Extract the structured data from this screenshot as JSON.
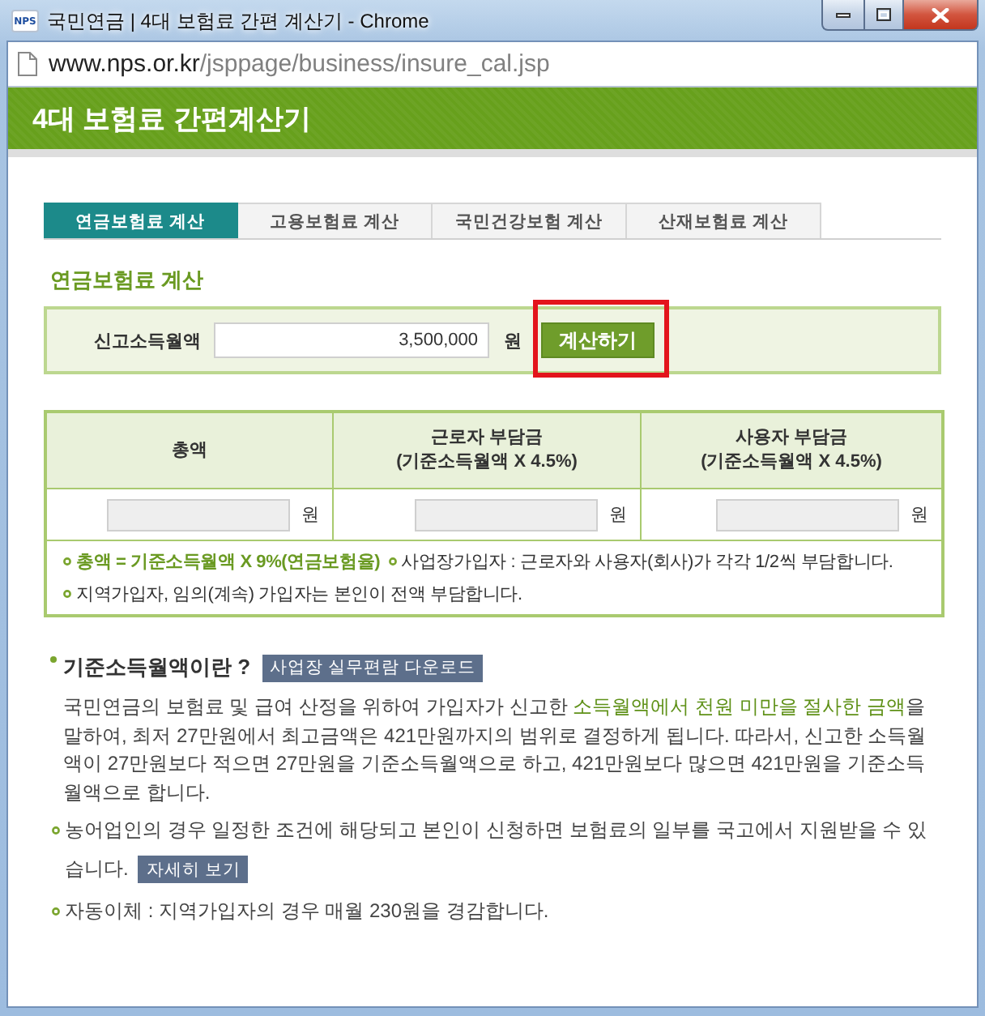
{
  "window": {
    "favicon_label": "NPS",
    "title": "국민연금 | 4대 보험료 간편 계산기 - Chrome"
  },
  "address_bar": {
    "host": "www.nps.or.kr",
    "path": "/jsppage/business/insure_cal.jsp"
  },
  "page_header": {
    "title": "4대 보험료 간편계산기"
  },
  "tabs": [
    {
      "label": "연금보험료 계산",
      "selected": true
    },
    {
      "label": "고용보험료 계산",
      "selected": false
    },
    {
      "label": "국민건강보험 계산",
      "selected": false
    },
    {
      "label": "산재보험료 계산",
      "selected": false
    }
  ],
  "section_title": "연금보험료 계산",
  "income_form": {
    "label": "신고소득월액",
    "value": "3,500,000",
    "unit": "원",
    "button": "계산하기",
    "highlighted": true
  },
  "result_table": {
    "columns": [
      {
        "title": "총액"
      },
      {
        "title": "근로자 부담금",
        "subtitle": "(기준소득월액 X 4.5%)"
      },
      {
        "title": "사용자 부담금",
        "subtitle": "(기준소득월액 X 4.5%)"
      }
    ],
    "units": [
      "원",
      "원",
      "원"
    ],
    "notes": [
      [
        {
          "text": "총액 = 기준소득월액 X 9%(연금보험율)",
          "highlight": true
        },
        {
          "text": "사업장가입자 : 근로자와 사용자(회사)가 각각 1/2씩 부담합니다.",
          "highlight": false
        }
      ],
      [
        {
          "text": "지역가입자, 임의(계속) 가입자는 본인이 전액 부담합니다.",
          "highlight": false
        }
      ]
    ]
  },
  "info": {
    "heading": "기준소득월액이란 ?",
    "heading_button": "사업장 실무편람 다운로드",
    "paragraph": [
      {
        "text": "국민연금의 보험료 및 급여 산정을 위하여 가입자가 신고한 ",
        "highlight": false
      },
      {
        "text": "소득월액에서 천원 미만을 절사한 금액",
        "highlight": true
      },
      {
        "text": "을 말하여, 최저 27만원에서 최고금액은 421만원까지의 범위로 결정하게 됩니다. 따라서, 신고한 소득월액이 27만원보다 적으면 27만원을 기준소득월액으로 하고, 421만원보다 많으면 421만원을 기준소득월액으로 합니다.",
        "highlight": false
      }
    ],
    "bullets": [
      {
        "text": "농어업인의 경우 일정한 조건에 해당되고 본인이 신청하면 보험료의 일부를 국고에서 지원받을 수 있습니다.",
        "button": "자세히 보기"
      },
      {
        "text": "자동이체 : 지역가입자의 경우 매월 230원을 경감합니다."
      }
    ]
  }
}
